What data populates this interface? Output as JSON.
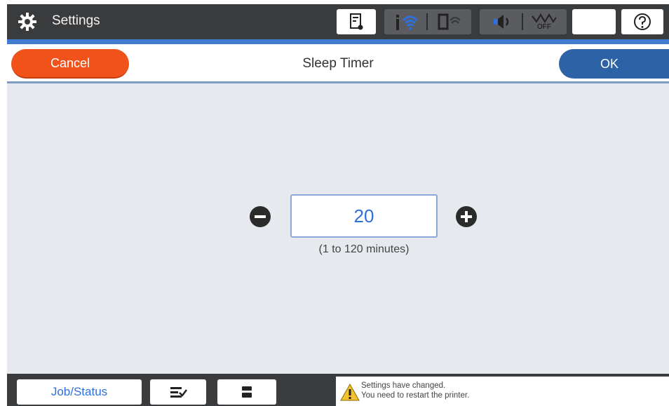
{
  "app": {
    "title": "Settings",
    "icon": "gear-icon"
  },
  "status_bar": {
    "icons": [
      "ink-icon",
      "wifi-icon",
      "wifi-direct-icon",
      "sound-icon",
      "ethernet-off-icon",
      "sleep-moon-icon",
      "help-icon"
    ],
    "ethernet_label": "OFF",
    "accent_color": "#3f7ccf"
  },
  "header": {
    "cancel_label": "Cancel",
    "screen_title": "Sleep Timer",
    "ok_label": "OK",
    "cancel_color": "#f0521a",
    "ok_color": "#2e62a6"
  },
  "stepper": {
    "value": "20",
    "range_hint": "(1 to 120 minutes)",
    "decrement_icon": "minus-icon",
    "increment_icon": "plus-icon"
  },
  "bottom_bar": {
    "job_status_label": "Job/Status",
    "icons": [
      "job-list-icon",
      "stop-icon",
      "warning-icon"
    ],
    "notice_line1": "Settings have changed.",
    "notice_line2": "You need to restart the printer."
  }
}
